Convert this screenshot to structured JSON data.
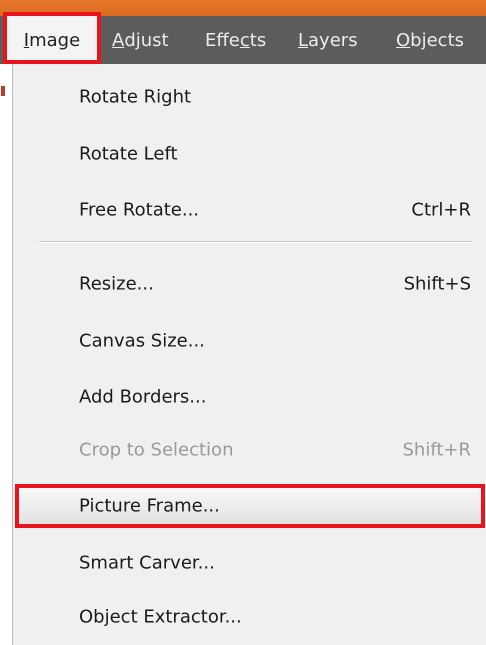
{
  "menubar": {
    "items": [
      {
        "accel": "I",
        "rest": "mage"
      },
      {
        "accel": "A",
        "rest": "djust"
      },
      {
        "pre": "Effe",
        "accel": "c",
        "rest": "ts"
      },
      {
        "accel": "L",
        "rest": "ayers"
      },
      {
        "accel": "O",
        "rest": "bjects"
      }
    ]
  },
  "dropdown": {
    "items": [
      {
        "label": "Rotate Right",
        "shortcut": ""
      },
      {
        "label": "Rotate Left",
        "shortcut": ""
      },
      {
        "label": "Free Rotate...",
        "shortcut": "Ctrl+R"
      },
      {
        "label": "Resize...",
        "shortcut": "Shift+S"
      },
      {
        "label": "Canvas Size...",
        "shortcut": ""
      },
      {
        "label": "Add Borders...",
        "shortcut": ""
      },
      {
        "label": "Crop to Selection",
        "shortcut": "Shift+R",
        "disabled": true
      },
      {
        "label": "Picture Frame...",
        "shortcut": "",
        "selected": true
      },
      {
        "label": "Smart Carver...",
        "shortcut": ""
      },
      {
        "label": "Object Extractor...",
        "shortcut": ""
      }
    ]
  },
  "colors": {
    "accent_orange": "#e8782a",
    "menubar_bg": "#5c5c5c",
    "highlight_red": "#e8141c",
    "menu_bg": "#f0f0f0",
    "disabled_text": "#9a9a9a"
  }
}
